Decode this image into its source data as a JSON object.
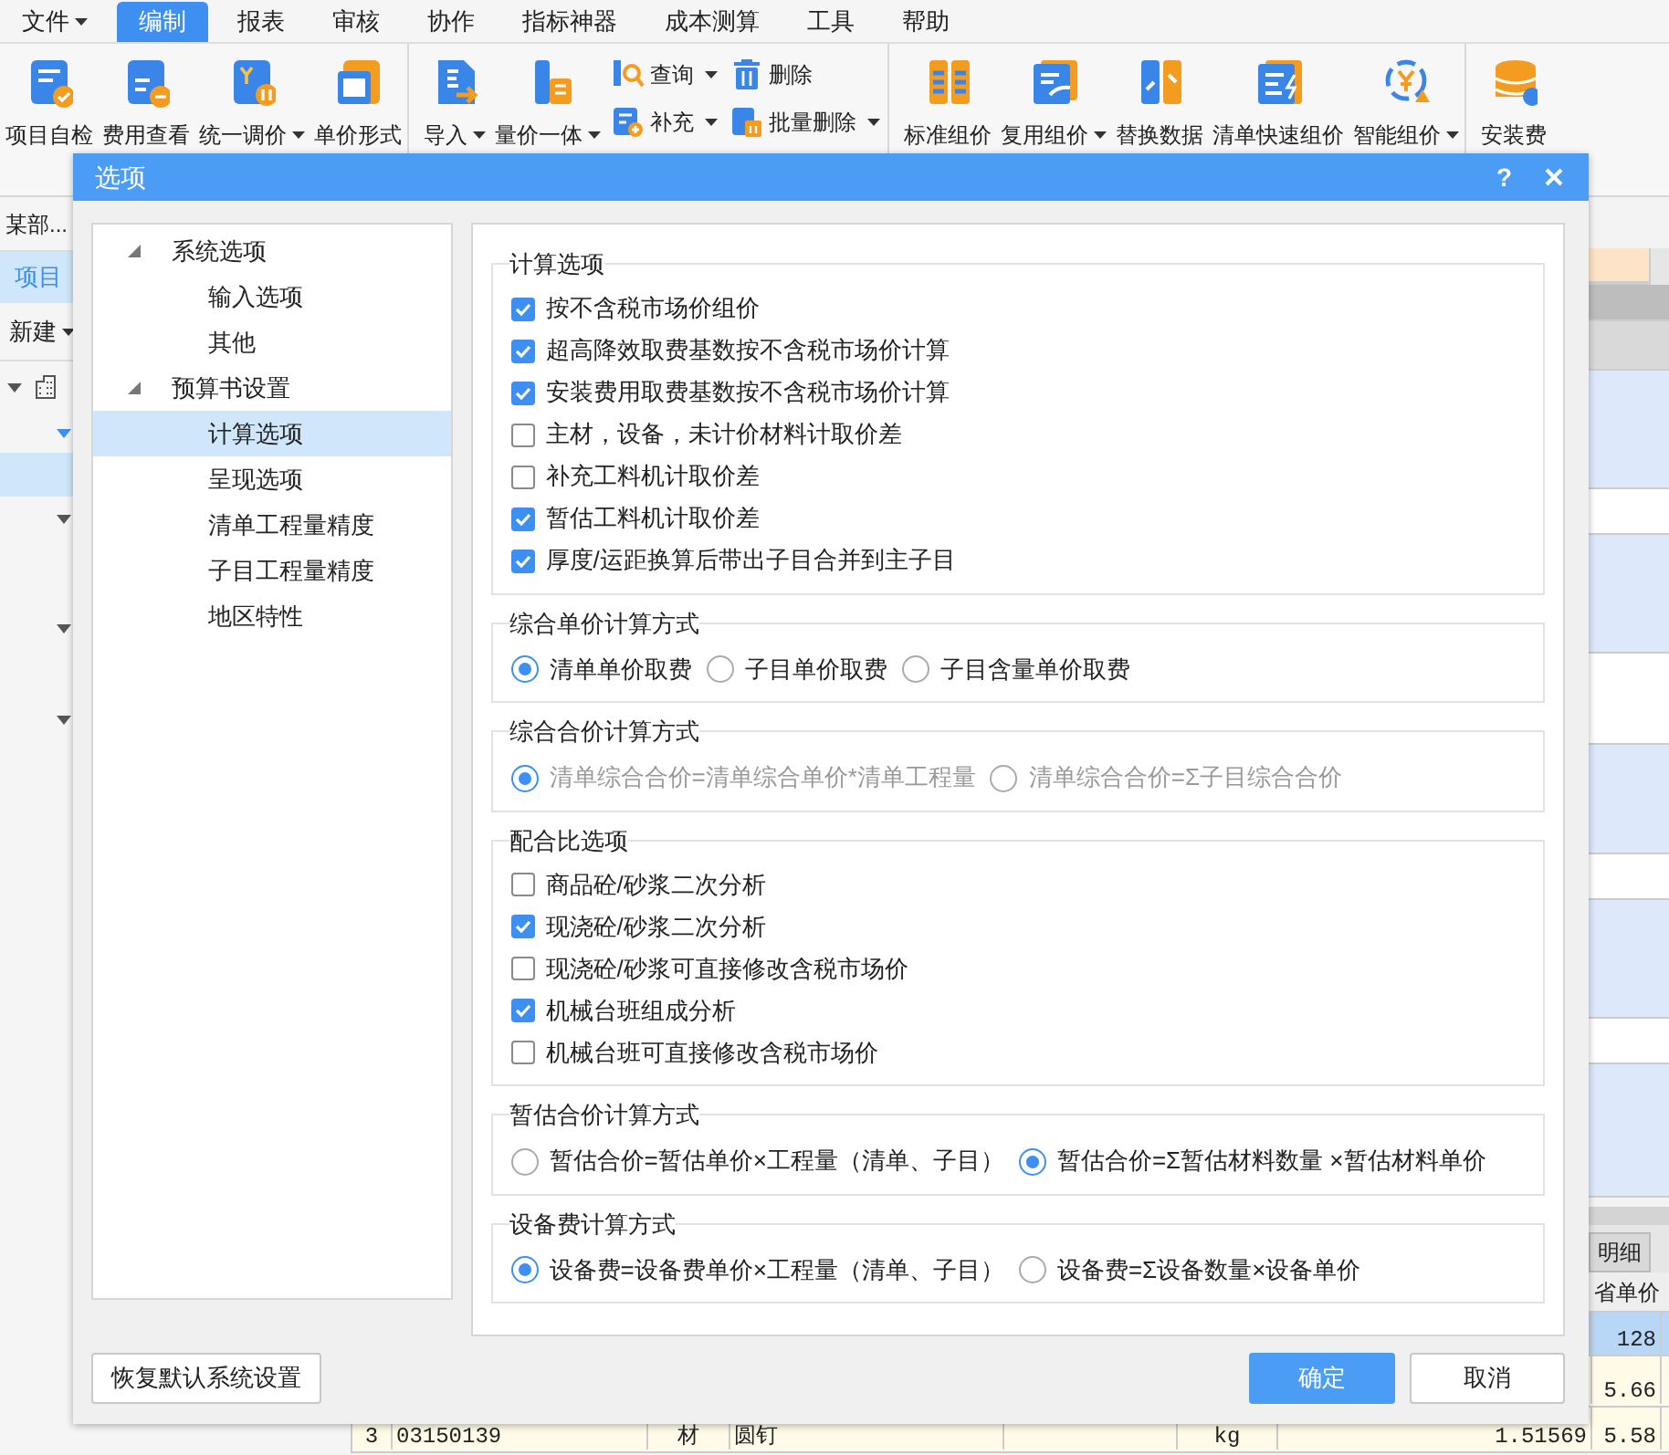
{
  "menu": [
    {
      "label": "文件",
      "caret": true,
      "selected": false
    },
    {
      "label": "编制",
      "caret": false,
      "selected": true
    },
    {
      "label": "报表",
      "caret": false,
      "selected": false
    },
    {
      "label": "审核",
      "caret": false,
      "selected": false
    },
    {
      "label": "协作",
      "caret": false,
      "selected": false
    },
    {
      "label": "指标神器",
      "caret": false,
      "selected": false
    },
    {
      "label": "成本测算",
      "caret": false,
      "selected": false
    },
    {
      "label": "工具",
      "caret": false,
      "selected": false
    },
    {
      "label": "帮助",
      "caret": false,
      "selected": false
    }
  ],
  "ribbon_groups": [
    [
      {
        "kind": "large",
        "label": "项目自检",
        "caret": false
      },
      {
        "kind": "large",
        "label": "费用查看",
        "caret": false
      },
      {
        "kind": "large",
        "label": "统一调价",
        "caret": true
      },
      {
        "kind": "large",
        "label": "单价形式",
        "caret": false
      }
    ],
    [
      {
        "kind": "large",
        "label": "导入",
        "caret": true
      },
      {
        "kind": "large",
        "label": "量价一体",
        "caret": true
      },
      {
        "kind": "stack",
        "items": [
          {
            "label": "查询",
            "caret": true
          },
          {
            "label": "补充",
            "caret": true
          }
        ]
      },
      {
        "kind": "stack",
        "items": [
          {
            "label": "删除",
            "caret": false
          },
          {
            "label": "批量删除",
            "caret": true
          }
        ]
      }
    ],
    [
      {
        "kind": "large",
        "label": "标准组价",
        "caret": false
      },
      {
        "kind": "large",
        "label": "复用组价",
        "caret": true
      },
      {
        "kind": "large",
        "label": "替换数据",
        "caret": false
      },
      {
        "kind": "large",
        "label": "清单快速组价",
        "caret": false
      },
      {
        "kind": "large",
        "label": "智能组价",
        "caret": true
      }
    ],
    [
      {
        "kind": "large",
        "label": "安装费",
        "caret": false
      }
    ]
  ],
  "side_panel": {
    "title": "某部...",
    "tab": "项目",
    "new_button": "新建"
  },
  "lower_tab": "明细",
  "lower_header": "省单价",
  "lower_rows": [
    {
      "price": "128",
      "selected": true
    },
    {
      "price": "5.66",
      "selected": false
    },
    {
      "num": "3",
      "code": "03150139",
      "type": "材",
      "name": "圆钉",
      "unit": "kg",
      "qty": "1.51569",
      "price": "5.58",
      "selected": false
    }
  ],
  "dialog": {
    "title": "选项",
    "help": "?",
    "tree": [
      {
        "label": "系统选项",
        "expanded": true,
        "selected": false,
        "children": [
          {
            "label": "输入选项",
            "selected": false
          },
          {
            "label": "其他",
            "selected": false
          }
        ]
      },
      {
        "label": "预算书设置",
        "expanded": true,
        "selected": false,
        "children": [
          {
            "label": "计算选项",
            "selected": true
          },
          {
            "label": "呈现选项",
            "selected": false
          },
          {
            "label": "清单工程量精度",
            "selected": false
          },
          {
            "label": "子目工程量精度",
            "selected": false
          },
          {
            "label": "地区特性",
            "selected": false
          }
        ]
      }
    ],
    "sections": [
      {
        "title": "计算选项",
        "kind": "checks",
        "disabled": false,
        "items": [
          {
            "label": "按不含税市场价组价",
            "checked": true
          },
          {
            "label": "超高降效取费基数按不含税市场价计算",
            "checked": true
          },
          {
            "label": "安装费用取费基数按不含税市场价计算",
            "checked": true
          },
          {
            "label": "主材，设备，未计价材料计取价差",
            "checked": false
          },
          {
            "label": "补充工料机计取价差",
            "checked": false
          },
          {
            "label": "暂估工料机计取价差",
            "checked": true
          },
          {
            "label": "厚度/运距换算后带出子目合并到主子目",
            "checked": true
          }
        ]
      },
      {
        "title": "综合单价计算方式",
        "kind": "radios",
        "disabled": false,
        "items": [
          {
            "label": "清单单价取费",
            "selected": true
          },
          {
            "label": "子目单价取费",
            "selected": false
          },
          {
            "label": "子目含量单价取费",
            "selected": false
          }
        ]
      },
      {
        "title": "综合合价计算方式",
        "kind": "radios",
        "disabled": true,
        "items": [
          {
            "label": "清单综合合价=清单综合单价*清单工程量",
            "selected": true
          },
          {
            "label": "清单综合合价=Σ子目综合合价",
            "selected": false
          }
        ]
      },
      {
        "title": "配合比选项",
        "kind": "checks",
        "disabled": false,
        "items": [
          {
            "label": "商品砼/砂浆二次分析",
            "checked": false
          },
          {
            "label": "现浇砼/砂浆二次分析",
            "checked": true
          },
          {
            "label": "现浇砼/砂浆可直接修改含税市场价",
            "checked": false
          },
          {
            "label": "机械台班组成分析",
            "checked": true
          },
          {
            "label": "机械台班可直接修改含税市场价",
            "checked": false
          }
        ]
      },
      {
        "title": "暂估合价计算方式",
        "kind": "radios",
        "disabled": false,
        "items": [
          {
            "label": "暂估合价=暂估单价×工程量（清单、子目）",
            "selected": false
          },
          {
            "label": "暂估合价=Σ暂估材料数量 ×暂估材料单价",
            "selected": true
          }
        ]
      },
      {
        "title": "设备费计算方式",
        "kind": "radios",
        "disabled": false,
        "items": [
          {
            "label": "设备费=设备费单价×工程量（清单、子目）",
            "selected": true
          },
          {
            "label": "设备费=Σ设备数量×设备单价",
            "selected": false
          }
        ]
      }
    ],
    "reset_button": "恢复默认系统设置",
    "ok_button": "确定",
    "cancel_button": "取消"
  }
}
